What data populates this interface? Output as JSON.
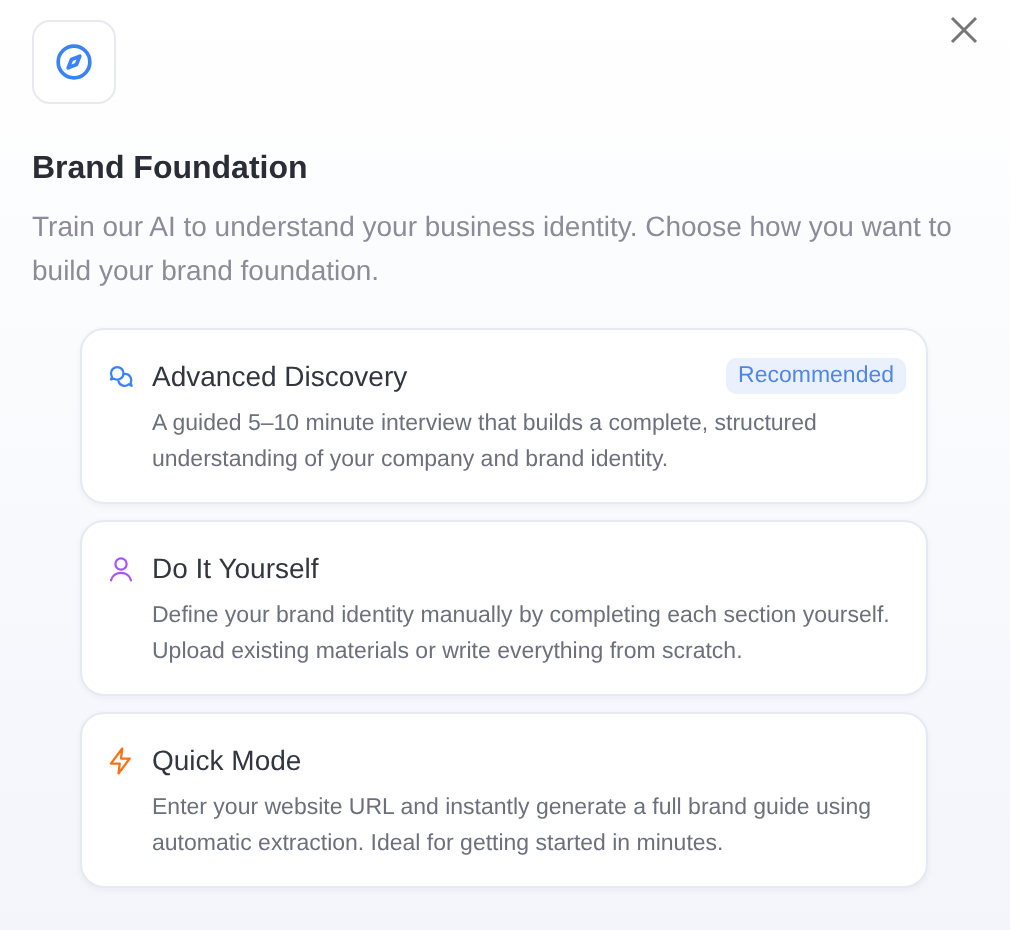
{
  "dialog": {
    "title": "Brand Foundation",
    "subtitle": "Train our AI to understand your business identity. Choose how you want to build your brand foundation.",
    "options": [
      {
        "kind": "chat",
        "color": "#3b82f6",
        "title": "Advanced Discovery",
        "badge": "Recommended",
        "description": "A guided 5–10 minute interview that builds a complete, structured understanding of your company and brand identity."
      },
      {
        "kind": "user",
        "color": "#a855f7",
        "title": "Do It Yourself",
        "description": "Define your brand identity manually by completing each section yourself. Upload existing materials or write everything from scratch."
      },
      {
        "kind": "bolt",
        "color": "#f97316",
        "title": "Quick Mode",
        "description": "Enter your website URL and instantly generate a full brand guide using automatic extraction. Ideal for getting started in minutes."
      }
    ]
  }
}
